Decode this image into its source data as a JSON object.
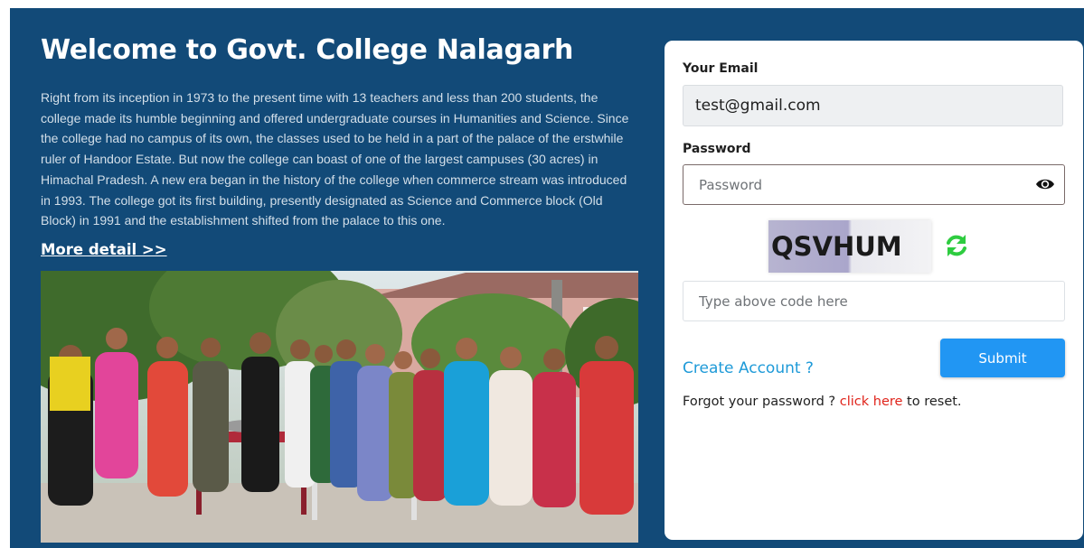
{
  "hero": {
    "title": "Welcome to Govt. College Nalagarh",
    "intro": "Right from its inception in 1973 to the present time with 13 teachers and less than 200 students, the college made its humble beginning and offered undergraduate courses in Humanities and Science. Since the college had no campus of its own, the classes used to be held in a part of the palace of the erstwhile ruler of Handoor Estate. But now the college can boast of one of the largest campuses (30 acres) in Himachal Pradesh. A new era began in the history of the college when commerce stream was introduced in 1993. The college got its first building, presently designated as Science and Commerce block (Old Block) in 1991 and the establishment shifted from the palace to this one.",
    "more_link": "More detail >>"
  },
  "login": {
    "email_label": "Your Email",
    "email_value": "test@gmail.com",
    "password_label": "Password",
    "password_placeholder": "Password",
    "captcha_text": "QSVHUM",
    "code_placeholder": "Type above code here",
    "submit_label": "Submit",
    "create_account": "Create Account ?",
    "forgot_prefix": "Forgot your password ? ",
    "forgot_link": "click here",
    "forgot_suffix": " to reset."
  },
  "colors": {
    "background": "#124a78",
    "accent": "#2196f3",
    "link": "#1e9ad8",
    "reset_link": "#e0241b",
    "refresh_icon": "#2ecc40"
  },
  "icons": {
    "show_password": "eye-icon",
    "refresh_captcha": "refresh-icon"
  }
}
